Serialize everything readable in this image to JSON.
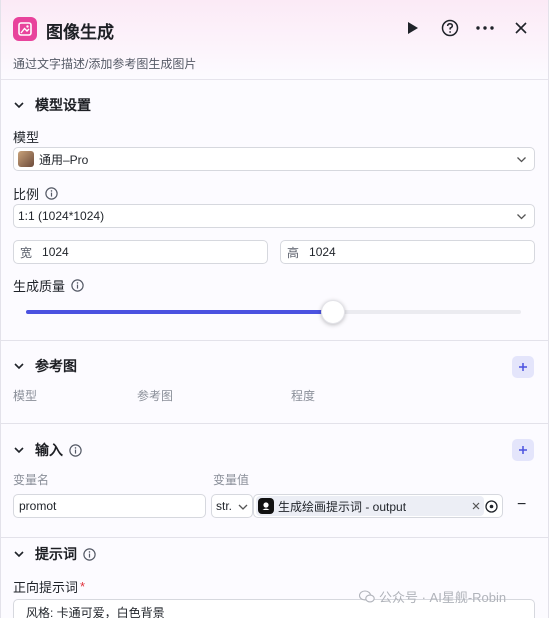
{
  "header": {
    "title": "图像生成",
    "subtitle": "通过文字描述/添加参考图生成图片"
  },
  "model_settings": {
    "section_title": "模型设置",
    "model_label": "模型",
    "model_value": "通用–Pro",
    "ratio_label": "比例",
    "ratio_value": "1:1 (1024*1024)",
    "width_prefix": "宽",
    "width_value": "1024",
    "height_prefix": "高",
    "height_value": "1024",
    "quality_label": "生成质量",
    "quality_level": 0.62
  },
  "reference": {
    "section_title": "参考图",
    "col_model": "模型",
    "col_ref": "参考图",
    "col_degree": "程度"
  },
  "inputs": {
    "section_title": "输入",
    "col_name": "变量名",
    "col_value": "变量值",
    "row": {
      "name": "promot",
      "type": "str.",
      "ref_text": "生成绘画提示词 - output",
      "remove": "−"
    }
  },
  "prompt": {
    "section_title": "提示词",
    "positive_label": "正向提示词",
    "required_mark": "*",
    "positive_value": "风格: 卡通可爱，白色背景"
  },
  "watermark": {
    "text": "公众号 · AI星舰-Robin"
  },
  "colors": {
    "accent": "#4b52e0",
    "brand_pink": "#e8439c"
  }
}
